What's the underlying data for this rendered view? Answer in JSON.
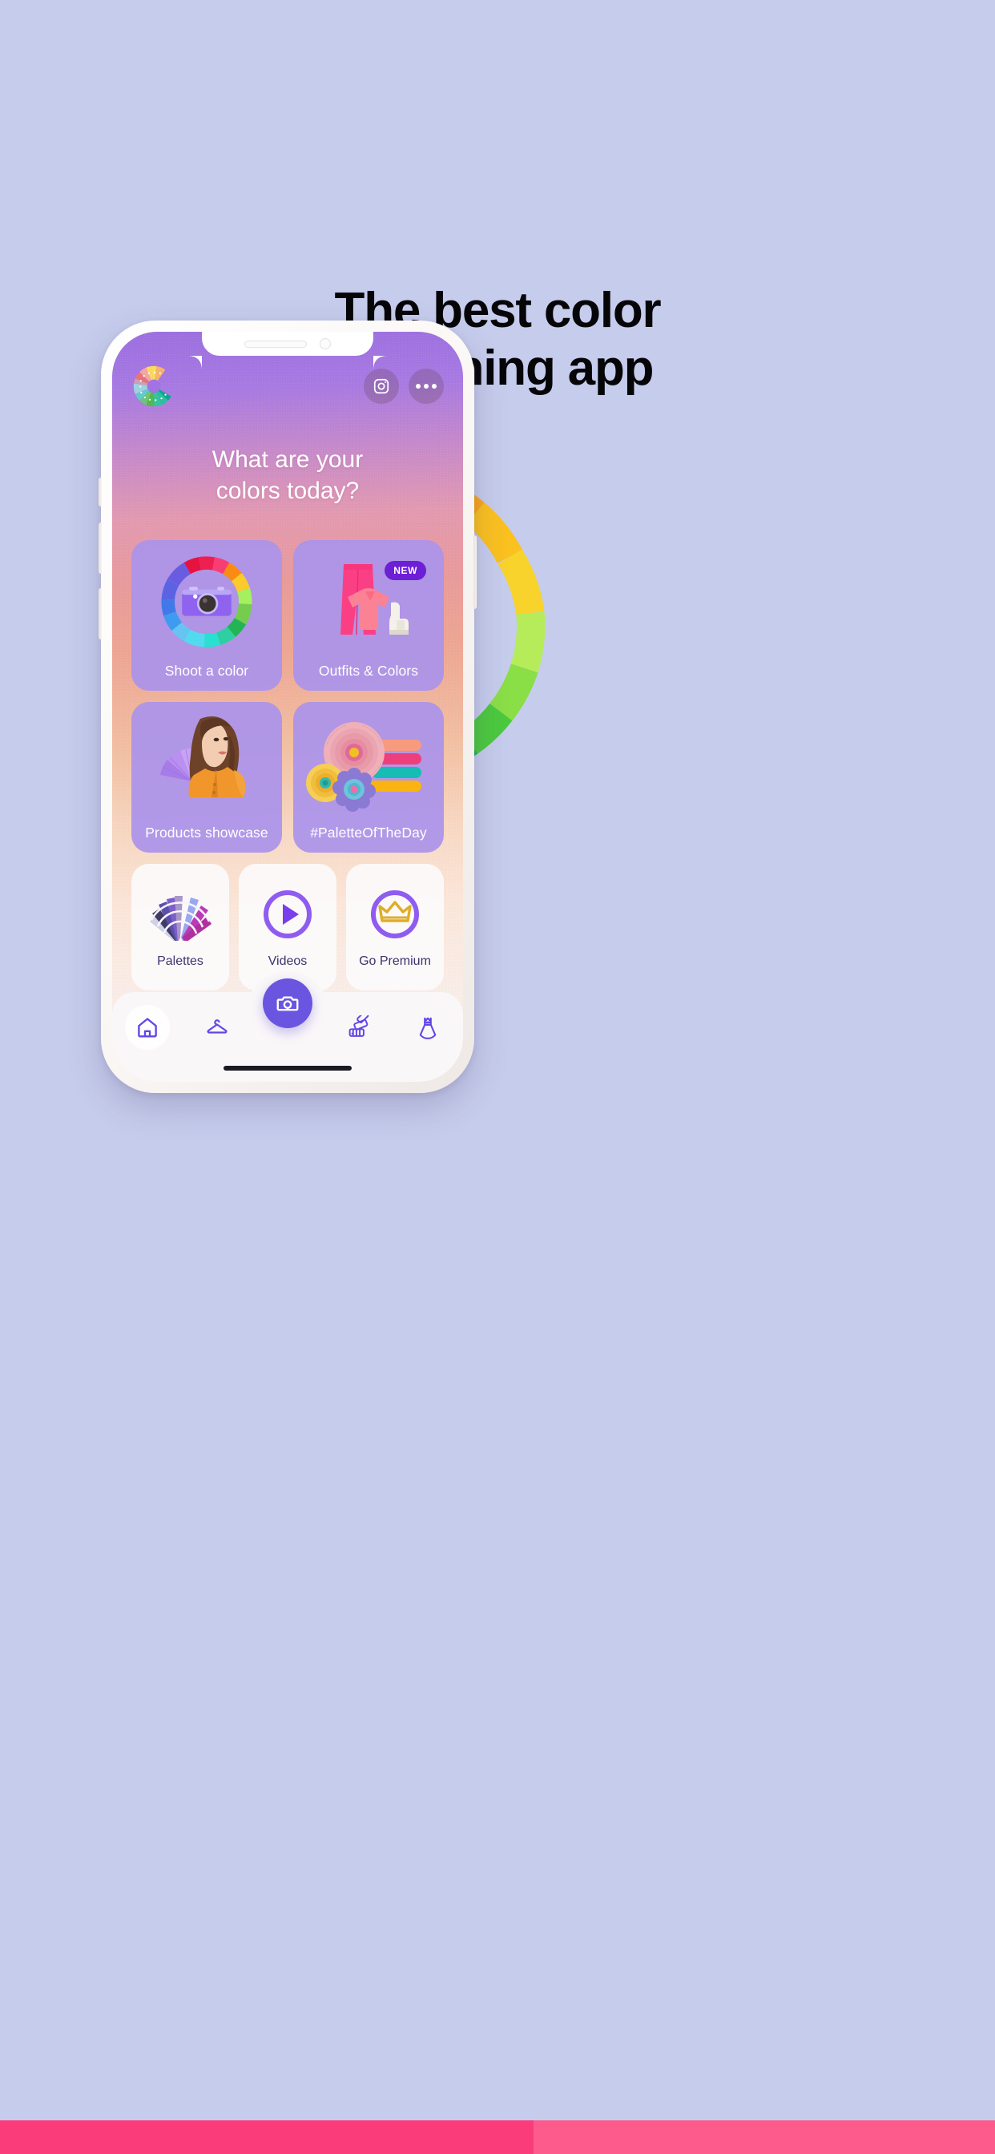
{
  "page": {
    "background_color": "#c6ccec",
    "headline_line1": "The best color",
    "headline_line2": "matching app"
  },
  "bottom_strip": {
    "left_color": "#fb3c7a",
    "right_color": "#fd5b8c"
  },
  "decor_wheel": {
    "name": "color-wheel-arc",
    "segments": [
      "#e8134f",
      "#f52e68",
      "#fb4c81",
      "#fb5d90",
      "#f9a81a",
      "#fbc11f",
      "#f8d32c",
      "#b6ec5a",
      "#8ade46",
      "#4cc93f",
      "#1db85a",
      "#12b98e",
      "#17b6b0"
    ]
  },
  "phone": {
    "app": {
      "logo_name": "color-wheel-logo",
      "header": {
        "instagram_label": "Instagram",
        "more_label": "More options"
      },
      "title_line1": "What are your",
      "title_line2": "colors today?",
      "main_cards": [
        {
          "name": "shoot-a-color",
          "label": "Shoot a color",
          "badge": null,
          "art": "camera-color-wheel"
        },
        {
          "name": "outfits-and-colors",
          "label": "Outfits & Colors",
          "badge": "NEW",
          "art": "outfit-pink"
        },
        {
          "name": "products-showcase",
          "label": "Products showcase",
          "badge": null,
          "art": "model-orange-dress"
        },
        {
          "name": "palette-of-the-day",
          "label": "#PaletteOfTheDay",
          "badge": null,
          "art": "paper-flowers"
        }
      ],
      "small_cards": [
        {
          "name": "palettes",
          "label": "Palettes",
          "icon": "swatch-fan-icon"
        },
        {
          "name": "videos",
          "label": "Videos",
          "icon": "play-circle-icon"
        },
        {
          "name": "go-premium",
          "label": "Go Premium",
          "icon": "crown-circle-icon"
        }
      ],
      "nav_items": [
        {
          "name": "nav-home",
          "icon": "home-icon",
          "active": true
        },
        {
          "name": "nav-wardrobe",
          "icon": "hanger-icon",
          "active": false
        },
        {
          "name": "nav-camera",
          "icon": "camera-icon",
          "active": false
        },
        {
          "name": "nav-palettes",
          "icon": "palette-fan-icon",
          "active": false
        },
        {
          "name": "nav-dress",
          "icon": "dress-icon",
          "active": false
        }
      ],
      "colors": {
        "card_purple": "#ab93eb",
        "badge_purple": "#6d1fd6",
        "accent_purple": "#6a55e0",
        "icon_purple": "#8f5cf0",
        "crown_gold": "#e0ad28",
        "caption_dark": "#3b3470"
      }
    }
  }
}
